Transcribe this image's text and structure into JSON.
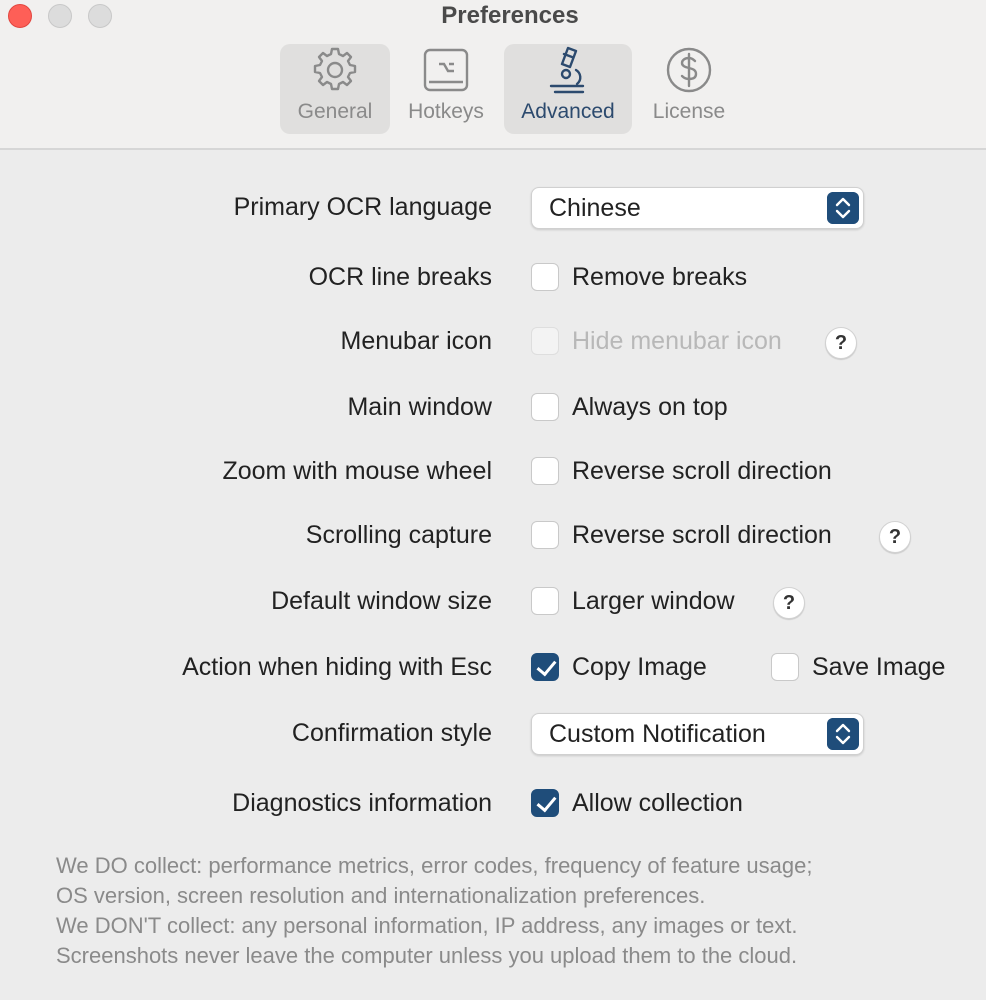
{
  "window": {
    "title": "Preferences"
  },
  "tabs": [
    {
      "label": "General",
      "icon": "gear-icon"
    },
    {
      "label": "Hotkeys",
      "icon": "keyboard-key-icon"
    },
    {
      "label": "Advanced",
      "icon": "microscope-icon"
    },
    {
      "label": "License",
      "icon": "dollar-icon"
    }
  ],
  "settings": {
    "ocr_language": {
      "label": "Primary OCR language",
      "value": "Chinese"
    },
    "line_breaks": {
      "label": "OCR line breaks",
      "option": "Remove breaks",
      "checked": false
    },
    "menubar_icon": {
      "label": "Menubar icon",
      "option": "Hide menubar icon",
      "checked": false,
      "disabled": true
    },
    "main_window": {
      "label": "Main window",
      "option": "Always on top",
      "checked": false
    },
    "zoom": {
      "label": "Zoom with mouse wheel",
      "option": "Reverse scroll direction",
      "checked": false
    },
    "scrolling_capture": {
      "label": "Scrolling capture",
      "option": "Reverse scroll direction",
      "checked": false
    },
    "window_size": {
      "label": "Default window size",
      "option": "Larger window",
      "checked": false
    },
    "esc_action": {
      "label": "Action when hiding with Esc",
      "copy": {
        "option": "Copy Image",
        "checked": true
      },
      "save": {
        "option": "Save Image",
        "checked": false
      }
    },
    "confirmation": {
      "label": "Confirmation style",
      "value": "Custom Notification"
    },
    "diagnostics": {
      "label": "Diagnostics information",
      "option": "Allow collection",
      "checked": true
    }
  },
  "help_glyph": "?",
  "info_lines": [
    "We DO collect: performance metrics, error codes, frequency of feature usage;",
    "OS version, screen resolution and internationalization preferences.",
    "We DON'T collect: any personal information, IP address, any images or text.",
    "Screenshots never leave the computer unless you upload them to the cloud."
  ],
  "colors": {
    "accent": "#1f4d7a",
    "close": "#fe5f57",
    "selected_tab_text": "#2c4a6e"
  }
}
